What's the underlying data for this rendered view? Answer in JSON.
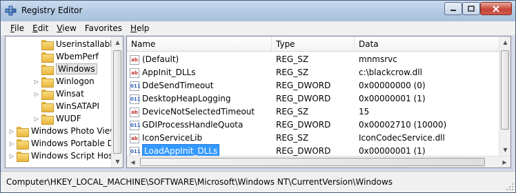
{
  "window": {
    "title": "Registry Editor",
    "controls": {
      "minimize": "minimize",
      "maximize": "maximize",
      "close": "close"
    }
  },
  "menu": {
    "items": [
      {
        "accel": "F",
        "rest": "ile"
      },
      {
        "accel": "E",
        "rest": "dit"
      },
      {
        "accel": "V",
        "rest": "iew"
      },
      {
        "accel": "",
        "rest": "Favorites"
      },
      {
        "accel": "H",
        "rest": "elp"
      }
    ]
  },
  "tree": {
    "items": [
      {
        "label": "Userinstallable.",
        "expandable": false,
        "selected": false
      },
      {
        "label": "WbemPerf",
        "expandable": false,
        "selected": false
      },
      {
        "label": "Windows",
        "expandable": false,
        "selected": true
      },
      {
        "label": "Winlogon",
        "expandable": true,
        "selected": false
      },
      {
        "label": "Winsat",
        "expandable": true,
        "selected": false
      },
      {
        "label": "WinSATAPI",
        "expandable": false,
        "selected": false
      },
      {
        "label": "WUDF",
        "expandable": true,
        "selected": false
      },
      {
        "label": "Windows Photo Viewe",
        "expandable": true,
        "selected": false
      },
      {
        "label": "Windows Portable Dev",
        "expandable": true,
        "selected": false
      },
      {
        "label": "Windows Script Host",
        "expandable": true,
        "selected": false
      }
    ]
  },
  "list": {
    "columns": {
      "name": "Name",
      "type": "Type",
      "data": "Data"
    },
    "rows": [
      {
        "icon": "ab",
        "kind": "sz",
        "name": "(Default)",
        "type": "REG_SZ",
        "data": "mnmsrvc",
        "selected": false
      },
      {
        "icon": "ab",
        "kind": "sz",
        "name": "AppInit_DLLs",
        "type": "REG_SZ",
        "data": "c:\\blackcrow.dll",
        "selected": false
      },
      {
        "icon": "011",
        "kind": "dword",
        "name": "DdeSendTimeout",
        "type": "REG_DWORD",
        "data": "0x00000000 (0)",
        "selected": false
      },
      {
        "icon": "011",
        "kind": "dword",
        "name": "DesktopHeapLogging",
        "type": "REG_DWORD",
        "data": "0x00000001 (1)",
        "selected": false
      },
      {
        "icon": "ab",
        "kind": "sz",
        "name": "DeviceNotSelectedTimeout",
        "type": "REG_SZ",
        "data": "15",
        "selected": false
      },
      {
        "icon": "011",
        "kind": "dword",
        "name": "GDIProcessHandleQuota",
        "type": "REG_DWORD",
        "data": "0x00002710 (10000)",
        "selected": false
      },
      {
        "icon": "ab",
        "kind": "sz",
        "name": "IconServiceLib",
        "type": "REG_SZ",
        "data": "IconCodecService.dll",
        "selected": false
      },
      {
        "icon": "011",
        "kind": "dword",
        "name": "LoadAppInit_DLLs",
        "type": "REG_DWORD",
        "data": "0x00000001 (1)",
        "selected": true
      }
    ]
  },
  "status": {
    "path": "Computer\\HKEY_LOCAL_MACHINE\\SOFTWARE\\Microsoft\\Windows NT\\CurrentVersion\\Windows"
  },
  "colors": {
    "selection": "#3399ff",
    "title_gradient_top": "#c9dbee",
    "close_button": "#c7443a"
  }
}
